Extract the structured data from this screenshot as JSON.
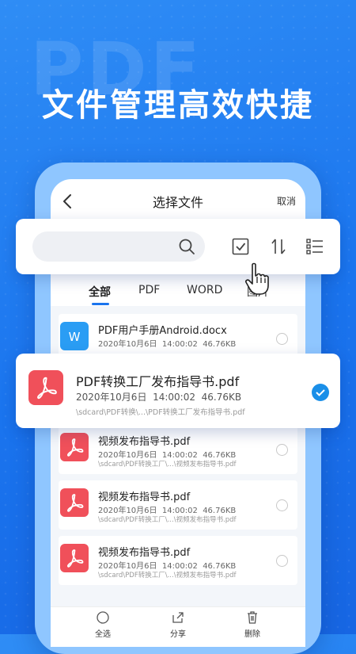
{
  "background": {
    "watermark": "PDF",
    "headline": "文件管理高效快捷",
    "accent_color": "#1a74ee"
  },
  "appbar": {
    "title": "选择文件",
    "cancel_label": "取消"
  },
  "search": {
    "value": "",
    "placeholder": ""
  },
  "tabs": [
    {
      "label": "全部"
    },
    {
      "label": "PDF"
    },
    {
      "label": "WORD"
    },
    {
      "label": "图片"
    }
  ],
  "files": [
    {
      "name": "PDF用户手册Android.docx",
      "date": "2020年10月6日",
      "time": "14:00:02",
      "size": "46.76KB",
      "type": "word-icon",
      "path": ""
    },
    {
      "name": "视频发布指导书.pdf",
      "date": "2020年10月6日",
      "time": "14:00:02",
      "size": "46.76KB",
      "type": "pdf-icon",
      "path": "\\sdcard\\PDF转换工厂\\...\\视频发布指导书.pdf"
    },
    {
      "name": "视频发布指导书.pdf",
      "date": "2020年10月6日",
      "time": "14:00:02",
      "size": "46.76KB",
      "type": "pdf-icon",
      "path": "\\sdcard\\PDF转换工厂\\...\\视频发布指导书.pdf"
    },
    {
      "name": "视频发布指导书.pdf",
      "date": "2020年10月6日",
      "time": "14:00:02",
      "size": "46.76KB",
      "type": "pdf-icon",
      "path": "\\sdcard\\PDF转换工厂\\...\\视频发布指导书.pdf"
    }
  ],
  "selected_file": {
    "name": "PDF转换工厂发布指导书.pdf",
    "date": "2020年10月6日",
    "time": "14:00:02",
    "size": "46.76KB",
    "path": "\\sdcard\\PDF转换\\...\\PDF转换工厂发布指导书.pdf",
    "type": "pdf-icon"
  },
  "bottom_bar": {
    "select_all": "全选",
    "share": "分享",
    "delete": "删除"
  }
}
